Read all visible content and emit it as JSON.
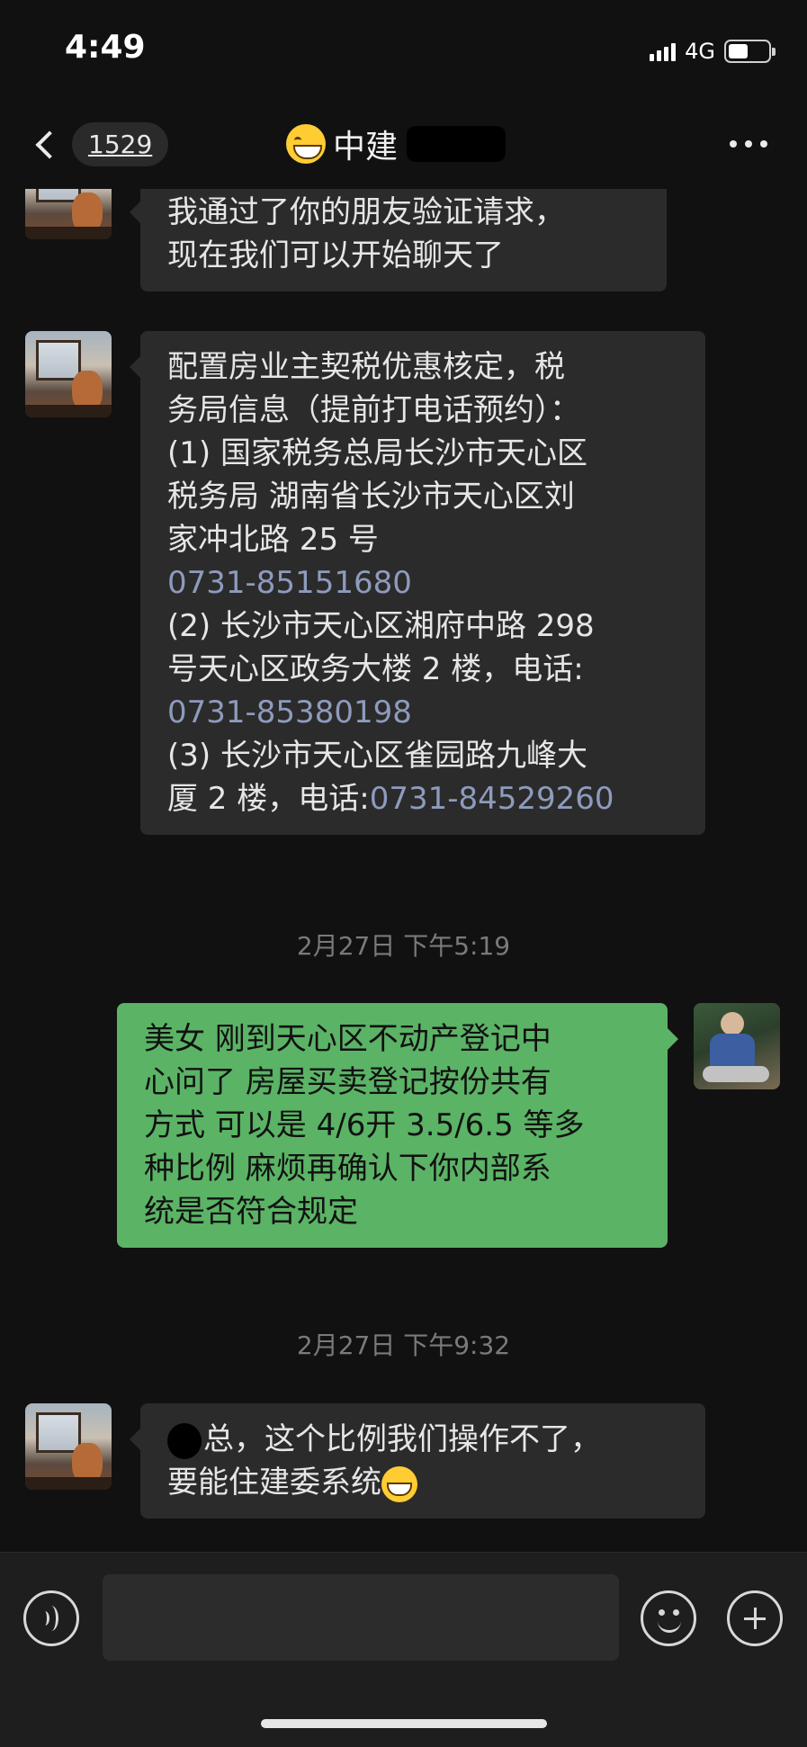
{
  "status": {
    "time": "4:49",
    "network": "4G"
  },
  "nav": {
    "unread_count": "1529",
    "title": "中建",
    "more_icon": "more-dots-icon",
    "back_icon": "chevron-left-icon"
  },
  "messages": [
    {
      "side": "in",
      "lines": [
        "我通过了你的朋友验证请求，",
        "现在我们可以开始聊天了"
      ]
    },
    {
      "side": "in",
      "lines": [
        "配置房业主契税优惠核定，税",
        "务局信息（提前打电话预约）：",
        "(1) 国家税务总局长沙市天心区",
        "税务局 湖南省长沙市天心区刘",
        "家冲北路 25 号",
        "0731-85151680",
        "(2) 长沙市天心区湘府中路 298",
        "号天心区政务大楼 2 楼，电话:",
        "0731-85380198",
        "(3) 长沙市天心区雀园路九峰大",
        "厦 2 楼，电话:",
        "0731-84529260"
      ]
    },
    {
      "side": "time",
      "text": "2月27日 下午5:19"
    },
    {
      "side": "out",
      "lines": [
        "美女 刚到天心区不动产登记中",
        "心问了 房屋买卖登记按份共有",
        "方式 可以是 4/6开 3.5/6.5 等多",
        "种比例 麻烦再确认下你内部系",
        "统是否符合规定"
      ]
    },
    {
      "side": "time",
      "text": "2月27日 下午9:32"
    },
    {
      "side": "in",
      "lines": [
        "总，这个比例我们操作不了，",
        "要能住建委系统"
      ]
    }
  ],
  "input": {
    "placeholder": ""
  },
  "colors": {
    "incoming_bubble": "#2b2b2b",
    "outgoing_bubble": "#5bb366",
    "phone_link": "#8e9bbd",
    "background": "#111111"
  }
}
